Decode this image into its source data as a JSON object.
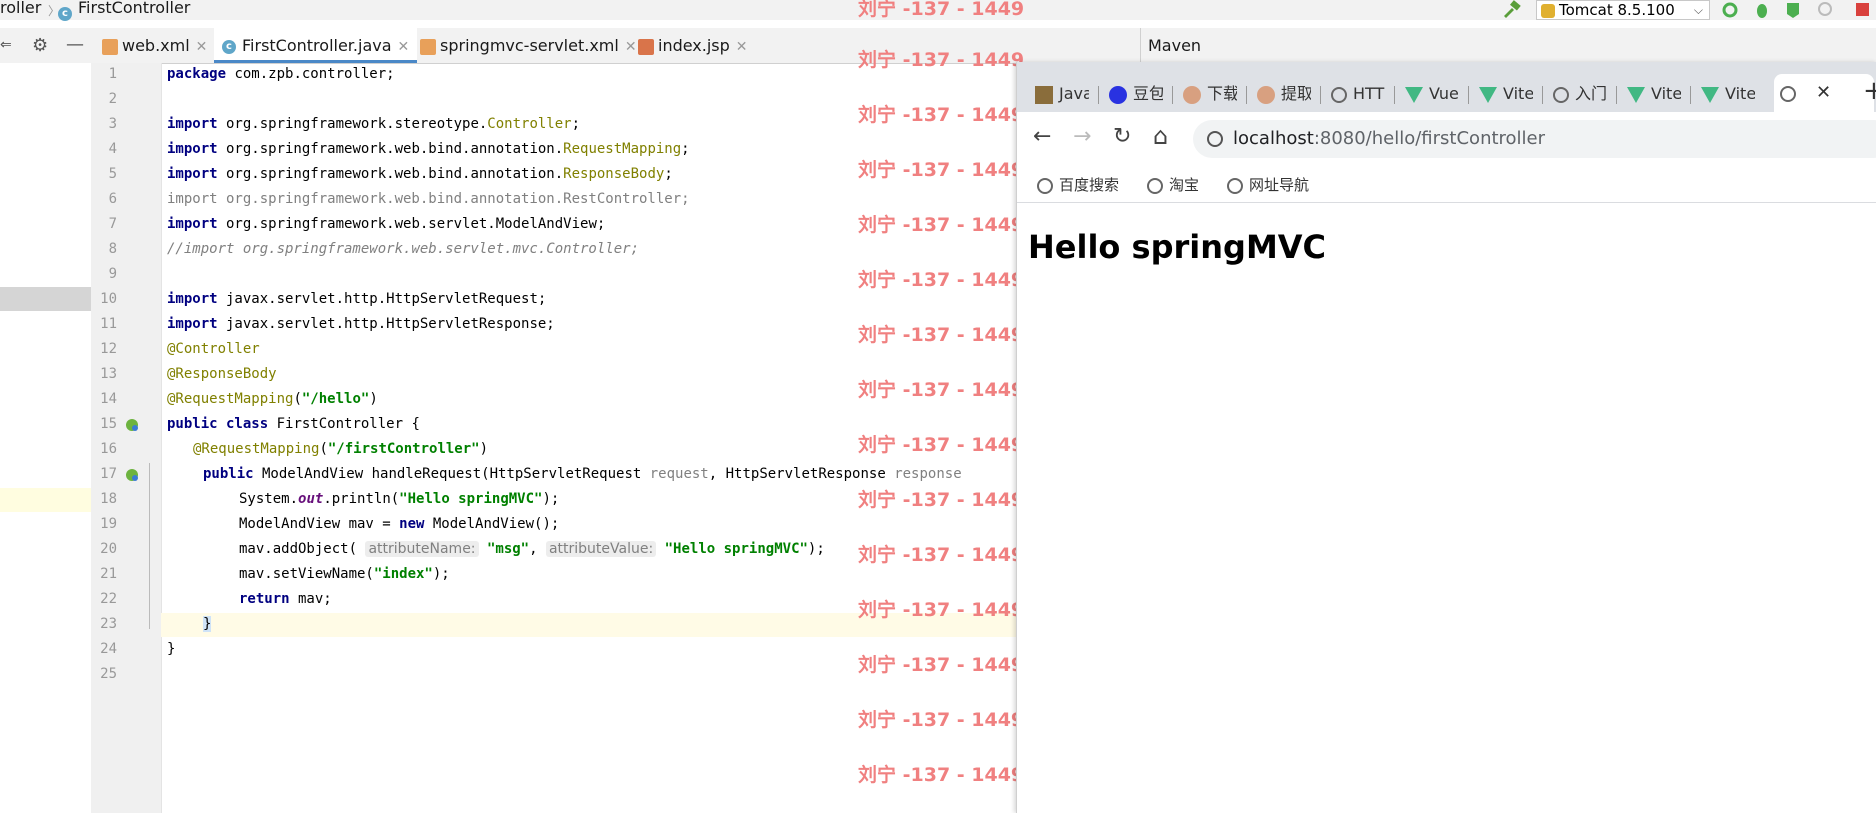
{
  "breadcrumb": {
    "part1": "roller",
    "sep": "〉",
    "part2": "FirstController"
  },
  "toolbar": {
    "run_config": "Tomcat 8.5.100"
  },
  "maven_label": "Maven",
  "editor_tabs": [
    {
      "label": "web.xml"
    },
    {
      "label": "FirstController.java"
    },
    {
      "label": "springmvc-servlet.xml"
    },
    {
      "label": "index.jsp"
    }
  ],
  "line_numbers": [
    "1",
    "2",
    "3",
    "4",
    "5",
    "6",
    "7",
    "8",
    "9",
    "10",
    "11",
    "12",
    "13",
    "14",
    "15",
    "16",
    "17",
    "18",
    "19",
    "20",
    "21",
    "22",
    "23",
    "24",
    "25"
  ],
  "code": {
    "l1_kw": "package",
    "l1_rest": " com.zpb.controller;",
    "l3_kw": "import",
    "l3_a": " org.springframework.stereotype.",
    "l3_b": "Controller",
    "l3_c": ";",
    "l4_kw": "import",
    "l4_a": " org.springframework.web.bind.annotation.",
    "l4_b": "RequestMapping",
    "l4_c": ";",
    "l5_kw": "import",
    "l5_a": " org.springframework.web.bind.annotation.",
    "l5_b": "ResponseBody",
    "l5_c": ";",
    "l6": "import org.springframework.web.bind.annotation.RestController;",
    "l7_kw": "import",
    "l7_rest": " org.springframework.web.servlet.ModelAndView;",
    "l8": "//import org.springframework.web.servlet.mvc.Controller;",
    "l10_kw": "import",
    "l10_rest": " javax.servlet.http.HttpServletRequest;",
    "l11_kw": "import",
    "l11_rest": " javax.servlet.http.HttpServletResponse;",
    "l12": "@Controller",
    "l13": "@ResponseBody",
    "l14_a": "@RequestMapping",
    "l14_b": "(",
    "l14_c": "\"/hello\"",
    "l14_d": ")",
    "l15_kw": "public class",
    "l15_rest": " FirstController {",
    "l16_a": "@RequestMapping",
    "l16_b": "(",
    "l16_c": "\"/firstController\"",
    "l16_d": ")",
    "l17_kw": "public",
    "l17_a": " ModelAndView handleRequest(HttpServletRequest ",
    "l17_b": "request",
    "l17_c": ", HttpServletResponse ",
    "l17_d": "response",
    "l18_a": "System.",
    "l18_b": "out",
    "l18_c": ".println(",
    "l18_d": "\"Hello springMVC\"",
    "l18_e": ");",
    "l19_a": "ModelAndView mav = ",
    "l19_kw": "new",
    "l19_b": " ModelAndView();",
    "l20_a": "mav.addObject( ",
    "l20_h1": "attributeName:",
    "l20_s1": " \"msg\"",
    "l20_b": ", ",
    "l20_h2": "attributeValue:",
    "l20_s2": " \"Hello springMVC\"",
    "l20_c": ");",
    "l21_a": "mav.setViewName(",
    "l21_s": "\"index\"",
    "l21_b": ");",
    "l22_kw": "return",
    "l22_rest": " mav;",
    "l23": "}",
    "l24": "}"
  },
  "watermark": "刘宁 -137 - 1449",
  "browser": {
    "tabs": [
      "Java",
      "豆包",
      "下载",
      "提取",
      "HTTP",
      "Vue",
      "Vite",
      "入门",
      "Vite",
      "Vite"
    ],
    "address_host": "localhost",
    "address_path": ":8080/hello/firstController",
    "bookmarks": [
      "百度搜索",
      "淘宝",
      "网址导航"
    ],
    "heading": "Hello springMVC"
  }
}
